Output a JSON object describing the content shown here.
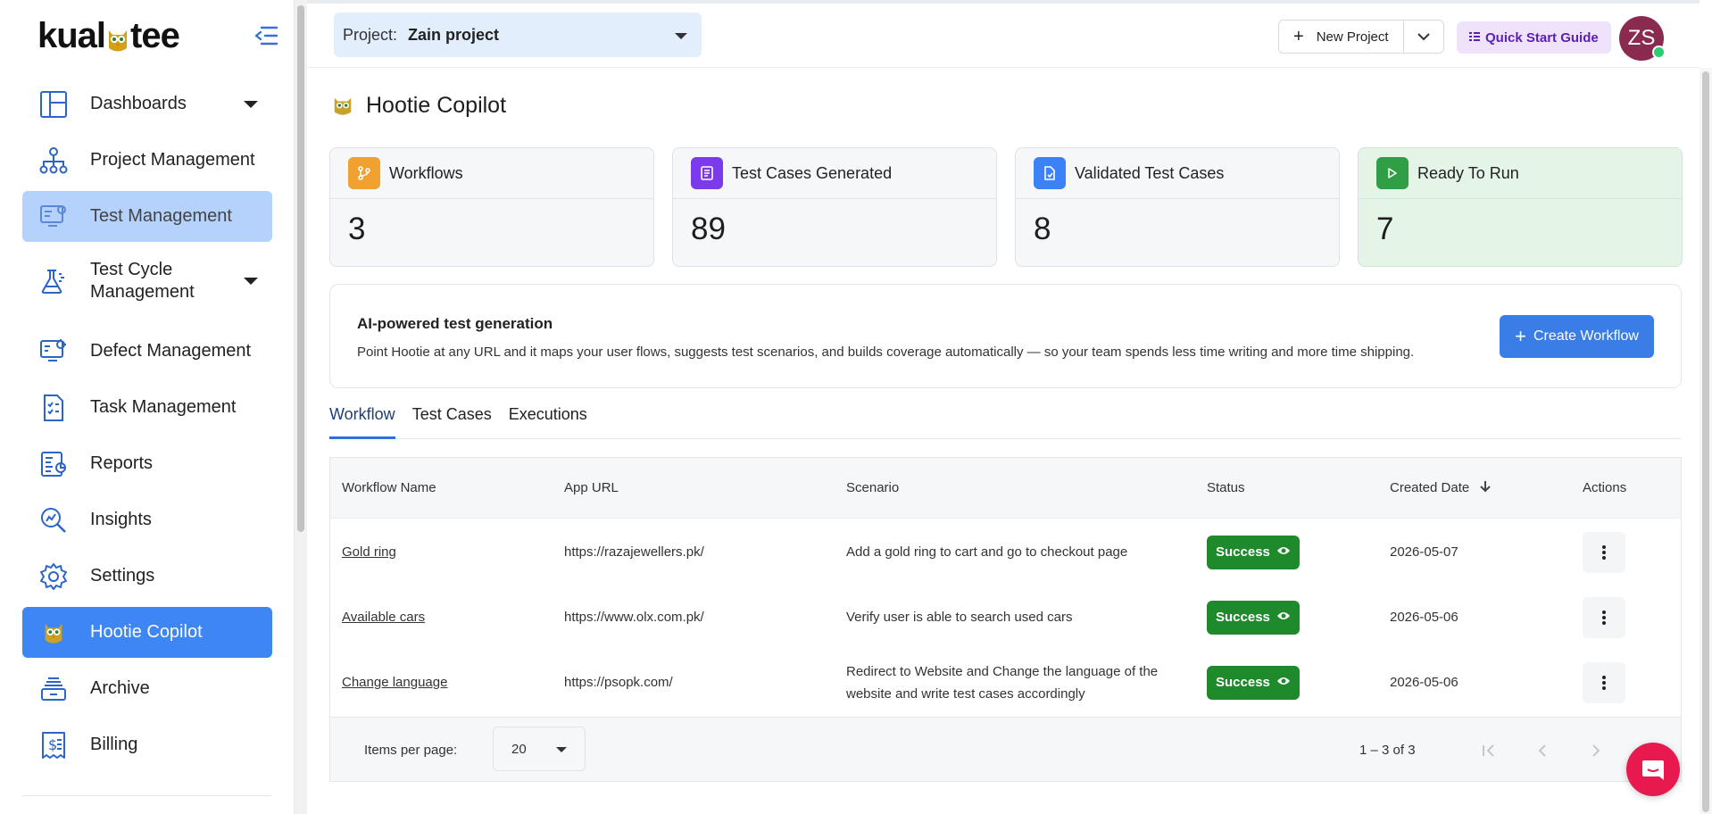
{
  "brand": {
    "logo_text_left": "kual",
    "logo_text_right": "tee",
    "accent": "#3d86f3"
  },
  "sidebar": {
    "items": [
      {
        "label": "Dashboards",
        "icon": "dashboard-icon"
      },
      {
        "label": "Project Management",
        "icon": "org-chart-icon"
      },
      {
        "label": "Test Management",
        "icon": "test-management-icon"
      },
      {
        "label": "Test Cycle Management",
        "icon": "flask-icon"
      },
      {
        "label": "Defect Management",
        "icon": "bug-monitor-icon"
      },
      {
        "label": "Task Management",
        "icon": "checklist-icon"
      },
      {
        "label": "Reports",
        "icon": "report-icon"
      },
      {
        "label": "Insights",
        "icon": "magnifier-chart-icon"
      },
      {
        "label": "Settings",
        "icon": "gear-icon"
      },
      {
        "label": "Hootie Copilot",
        "icon": "owl-icon"
      },
      {
        "label": "Archive",
        "icon": "archive-icon"
      },
      {
        "label": "Billing",
        "icon": "billing-icon"
      }
    ]
  },
  "header": {
    "project_label": "Project:",
    "project_value": "Zain project",
    "new_project": "New Project",
    "quick_start": "Quick Start Guide",
    "avatar_initials": "ZS"
  },
  "page": {
    "title": "Hootie Copilot"
  },
  "stats": [
    {
      "label": "Workflows",
      "value": "3",
      "color": "#f0a12f"
    },
    {
      "label": "Test Cases Generated",
      "value": "89",
      "color": "#7c3aed"
    },
    {
      "label": "Validated Test Cases",
      "value": "8",
      "color": "#3b82f6"
    },
    {
      "label": "Ready To Run",
      "value": "7",
      "color": "#2f9e44"
    }
  ],
  "ai": {
    "title": "AI-powered test generation",
    "description": "Point Hootie at any URL and it maps your user flows, suggests test scenarios, and builds coverage automatically — so your team spends less time writing and more time shipping.",
    "button": "Create Workflow"
  },
  "tabs": [
    "Workflow",
    "Test Cases",
    "Executions"
  ],
  "table": {
    "headers": {
      "name": "Workflow Name",
      "url": "App URL",
      "scenario": "Scenario",
      "status": "Status",
      "date": "Created Date",
      "actions": "Actions"
    },
    "rows": [
      {
        "name": "Gold ring",
        "url": "https://razajewellers.pk/",
        "scenario": "Add a gold ring to cart and go to checkout page",
        "status": "Success",
        "date": "2026-05-07"
      },
      {
        "name": "Available cars",
        "url": "https://www.olx.com.pk/",
        "scenario": "Verify user is able to search used cars",
        "status": "Success",
        "date": "2026-05-06"
      },
      {
        "name": "Change language",
        "url": "https://psopk.com/",
        "scenario": "Redirect to Website and Change the language of the website and write test cases accordingly",
        "status": "Success",
        "date": "2026-05-06"
      }
    ],
    "footer": {
      "items_per_page_label": "Items per page:",
      "items_per_page": "20",
      "range": "1 – 3 of 3"
    }
  }
}
